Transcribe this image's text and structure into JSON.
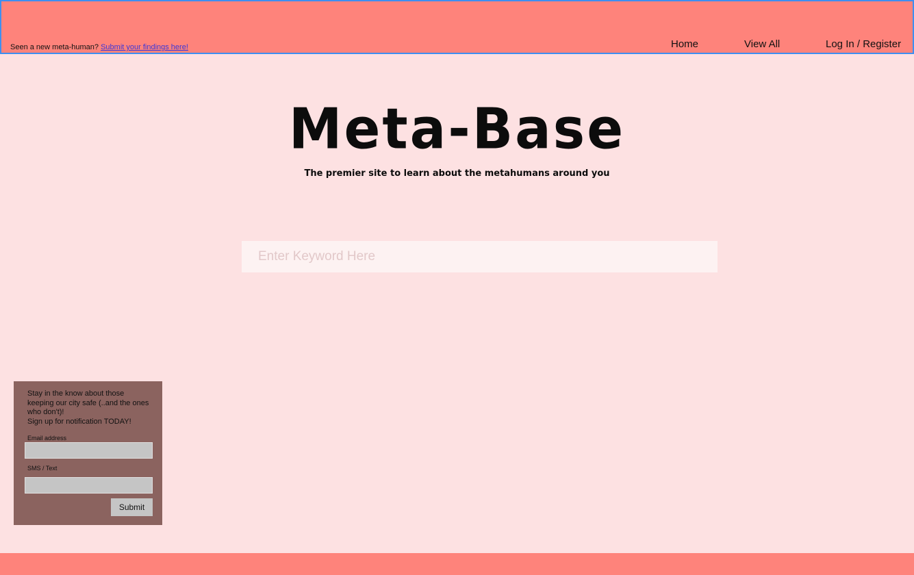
{
  "header": {
    "submit_prompt": "Seen a new meta-human?",
    "submit_link": "Submit your findings here!",
    "nav": {
      "home": "Home",
      "view_all": "View All",
      "login": "Log In / Register"
    }
  },
  "hero": {
    "title": "Meta-Base",
    "tagline": "The premier site to learn about the metahumans around you"
  },
  "search": {
    "placeholder": "Enter Keyword Here",
    "value": ""
  },
  "signup": {
    "line1": "Stay in the know about those keeping our city safe (..and the ones who don't)!",
    "line2": "Sign up for notification TODAY!",
    "email_label": "Email address",
    "sms_label": "SMS / Text",
    "submit_label": "Submit"
  },
  "colors": {
    "header_bg": "#fe837b",
    "page_bg": "#fde1e2",
    "header_border": "#3e8ef0",
    "signup_bg": "#8b635f",
    "link": "#3b36d8"
  }
}
